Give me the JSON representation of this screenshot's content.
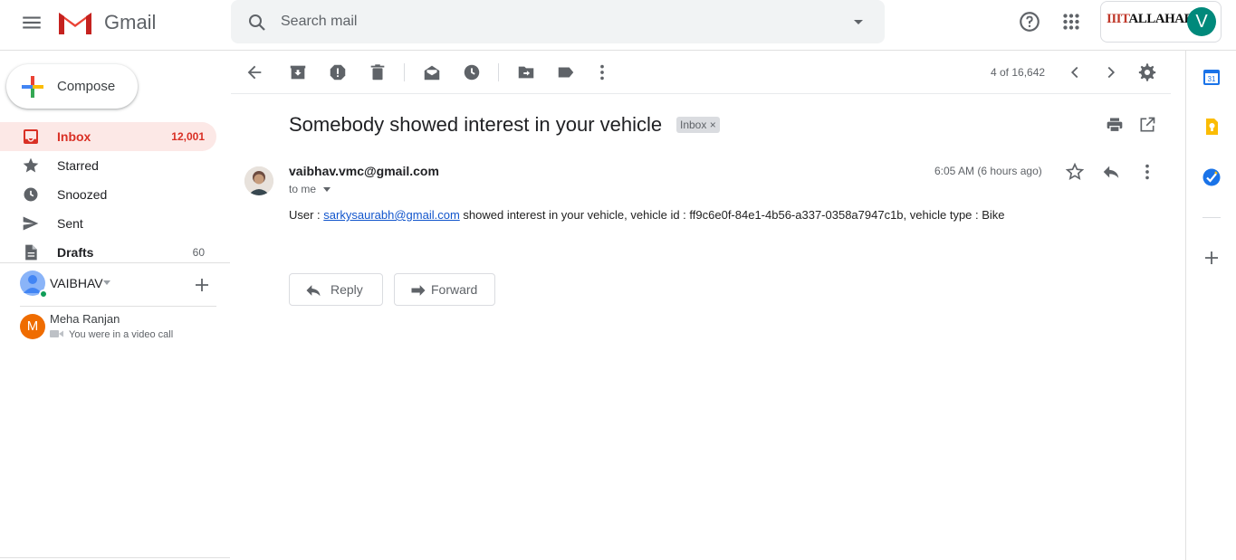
{
  "app": {
    "name": "Gmail"
  },
  "search": {
    "placeholder": "Search mail"
  },
  "account": {
    "org_logo_prefix": "IIIT",
    "org_logo_rest": "ALLAHABAD",
    "avatar_letter": "V"
  },
  "compose": {
    "label": "Compose"
  },
  "sidebar": {
    "items": [
      {
        "label": "Inbox",
        "count": "12,001",
        "icon": "inbox-icon",
        "active": true
      },
      {
        "label": "Starred",
        "count": "",
        "icon": "star-icon"
      },
      {
        "label": "Snoozed",
        "count": "",
        "icon": "clock-icon"
      },
      {
        "label": "Sent",
        "count": "",
        "icon": "send-icon"
      },
      {
        "label": "Drafts",
        "count": "60",
        "icon": "draft-icon"
      }
    ]
  },
  "hangouts": {
    "user": "VAIBHAV",
    "contacts": [
      {
        "initial": "M",
        "name": "Meha Ranjan",
        "status": "You were in a video call"
      }
    ]
  },
  "toolbar": {
    "page_count": "4 of 16,642"
  },
  "message": {
    "subject": "Somebody showed interest in your vehicle",
    "label": "Inbox",
    "sender": "vaibhav.vmc@gmail.com",
    "to": "to me",
    "time": "6:05 AM (6 hours ago)",
    "body_prefix": "User : ",
    "body_link": "sarkysaurabh@gmail.com",
    "body_suffix": " showed interest in your vehicle, vehicle id : ff9c6e0f-84e1-4b56-a337-0358a7947c1b, vehicle type : Bike"
  },
  "actions": {
    "reply": "Reply",
    "forward": "Forward"
  },
  "colors": {
    "accent": "#d93025",
    "active_bg": "#fce8e6",
    "link": "#1155cc"
  }
}
